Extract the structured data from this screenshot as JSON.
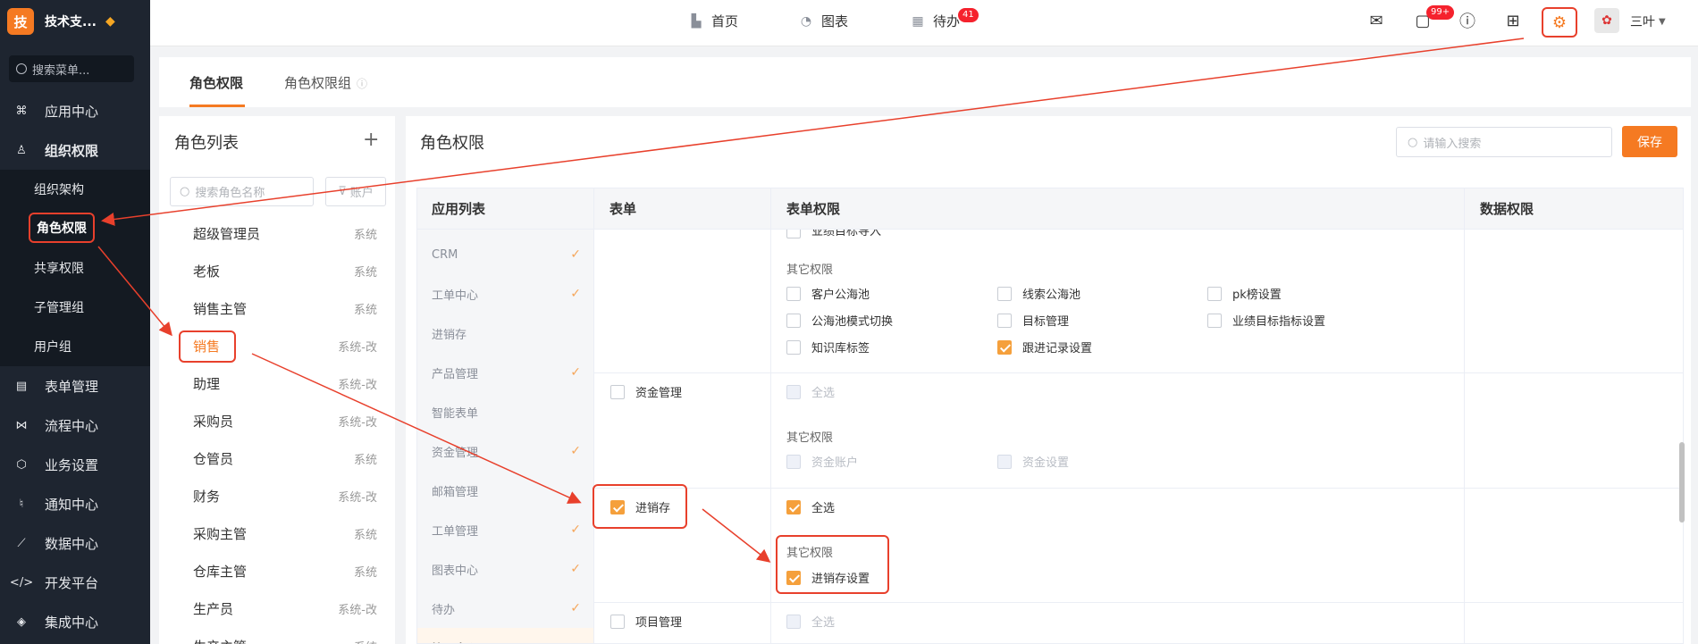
{
  "brand": {
    "logo_char": "技",
    "name": "技术支..."
  },
  "sidebar": {
    "search_placeholder": "搜索菜单...",
    "items": [
      {
        "label": "应用中心",
        "icon": "apps-icon"
      },
      {
        "label": "组织权限",
        "icon": "user-icon"
      },
      {
        "label": "表单管理",
        "icon": "form-icon"
      },
      {
        "label": "流程中心",
        "icon": "flow-icon"
      },
      {
        "label": "业务设置",
        "icon": "cube-icon"
      },
      {
        "label": "通知中心",
        "icon": "bell-icon"
      },
      {
        "label": "数据中心",
        "icon": "chart-icon"
      },
      {
        "label": "开发平台",
        "icon": "code-icon"
      },
      {
        "label": "集成中心",
        "icon": "layers-icon"
      }
    ],
    "subitems": [
      "组织架构",
      "角色权限",
      "共享权限",
      "子管理组",
      "用户组"
    ]
  },
  "topbar": {
    "nav": [
      {
        "label": "首页"
      },
      {
        "label": "图表"
      },
      {
        "label": "待办",
        "badge": "41"
      }
    ],
    "message_badge": "99+",
    "user_name": "三叶"
  },
  "tabs": [
    "角色权限",
    "角色权限组"
  ],
  "role_panel": {
    "title": "角色列表",
    "search_placeholder": "搜索角色名称",
    "filter_label": "账户",
    "roles": [
      {
        "name": "超级管理员",
        "tag": "系统"
      },
      {
        "name": "老板",
        "tag": "系统"
      },
      {
        "name": "销售主管",
        "tag": "系统"
      },
      {
        "name": "销售",
        "tag": "系统-改"
      },
      {
        "name": "助理",
        "tag": "系统-改"
      },
      {
        "name": "采购员",
        "tag": "系统-改"
      },
      {
        "name": "仓管员",
        "tag": "系统"
      },
      {
        "name": "财务",
        "tag": "系统-改"
      },
      {
        "name": "采购主管",
        "tag": "系统"
      },
      {
        "name": "仓库主管",
        "tag": "系统"
      },
      {
        "name": "生产员",
        "tag": "系统-改"
      },
      {
        "name": "生产主管",
        "tag": "系统"
      }
    ]
  },
  "main_panel": {
    "title": "角色权限",
    "search_placeholder": "请输入搜索",
    "save_label": "保存",
    "columns": [
      "应用列表",
      "表单",
      "表单权限",
      "数据权限"
    ],
    "apps": [
      {
        "name": "CRM",
        "checked": true
      },
      {
        "name": "工单中心",
        "checked": true
      },
      {
        "name": "进销存",
        "checked": false
      },
      {
        "name": "产品管理",
        "checked": true
      },
      {
        "name": "智能表单",
        "checked": false
      },
      {
        "name": "资金管理",
        "checked": true
      },
      {
        "name": "邮箱管理",
        "checked": false
      },
      {
        "name": "工单管理",
        "checked": true
      },
      {
        "name": "图表中心",
        "checked": true
      },
      {
        "name": "待办",
        "checked": true
      },
      {
        "name": "管理中心",
        "checked": true
      }
    ],
    "other_perms_label": "其它权限",
    "select_all_label": "全选",
    "top_cut_text": "业绩目标导入",
    "crm_perms": [
      {
        "label": "客户公海池",
        "checked": false
      },
      {
        "label": "线索公海池",
        "checked": false
      },
      {
        "label": "pk榜设置",
        "checked": false
      },
      {
        "label": "公海池模式切换",
        "checked": false
      },
      {
        "label": "目标管理",
        "checked": false
      },
      {
        "label": "业绩目标指标设置",
        "checked": false
      },
      {
        "label": "知识库标签",
        "checked": false
      },
      {
        "label": "跟进记录设置",
        "checked": true
      }
    ],
    "forms": [
      {
        "name": "资金管理",
        "checked": false,
        "perms": [
          "资金账户",
          "资金设置"
        ]
      },
      {
        "name": "进销存",
        "checked": true,
        "perms": [
          "进销存设置"
        ]
      },
      {
        "name": "项目管理",
        "checked": false,
        "perms": []
      }
    ]
  },
  "colors": {
    "accent": "#f57a22",
    "annotation": "#e8402c",
    "sidebar_bg": "#1e2530"
  }
}
